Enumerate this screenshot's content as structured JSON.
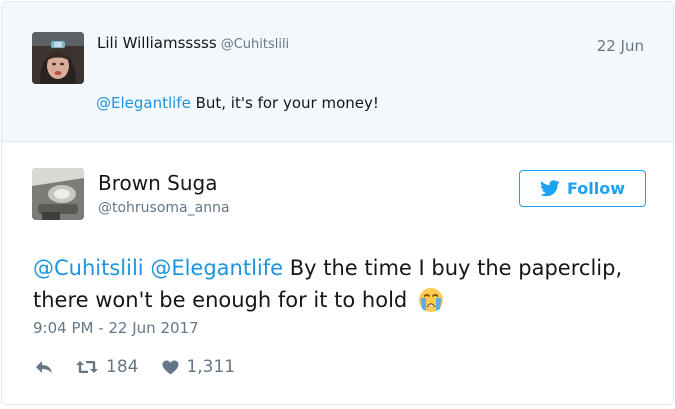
{
  "parent_tweet": {
    "author_name": "Lili Williamsssss",
    "author_handle": "@Cuhitslili",
    "date": "22 Jun",
    "mention": "@Elegantlife",
    "text": " But, it's for your money!"
  },
  "main_tweet": {
    "author_name": "Brown Suga",
    "author_handle": "@tohrusoma_anna",
    "follow_label": "Follow",
    "mention_1": "@Cuhitslili",
    "mention_2": "@Elegantlife",
    "text": " By the time I buy the paperclip, there won't be enough for it to hold",
    "emoji": "loudly-crying-face",
    "timestamp": "9:04 PM - 22 Jun 2017",
    "retweet_count": "184",
    "like_count": "1,311"
  },
  "icons": [
    "twitter-bird-icon",
    "reply-icon",
    "retweet-icon",
    "heart-icon",
    "loudly-crying-face-emoji"
  ],
  "colors": {
    "link": "#1b95e0",
    "twitter_blue": "#1da1f2",
    "muted_text": "#657786",
    "text": "#14171a",
    "parent_background": "#f5f8fa",
    "border": "#e1e8ed"
  }
}
